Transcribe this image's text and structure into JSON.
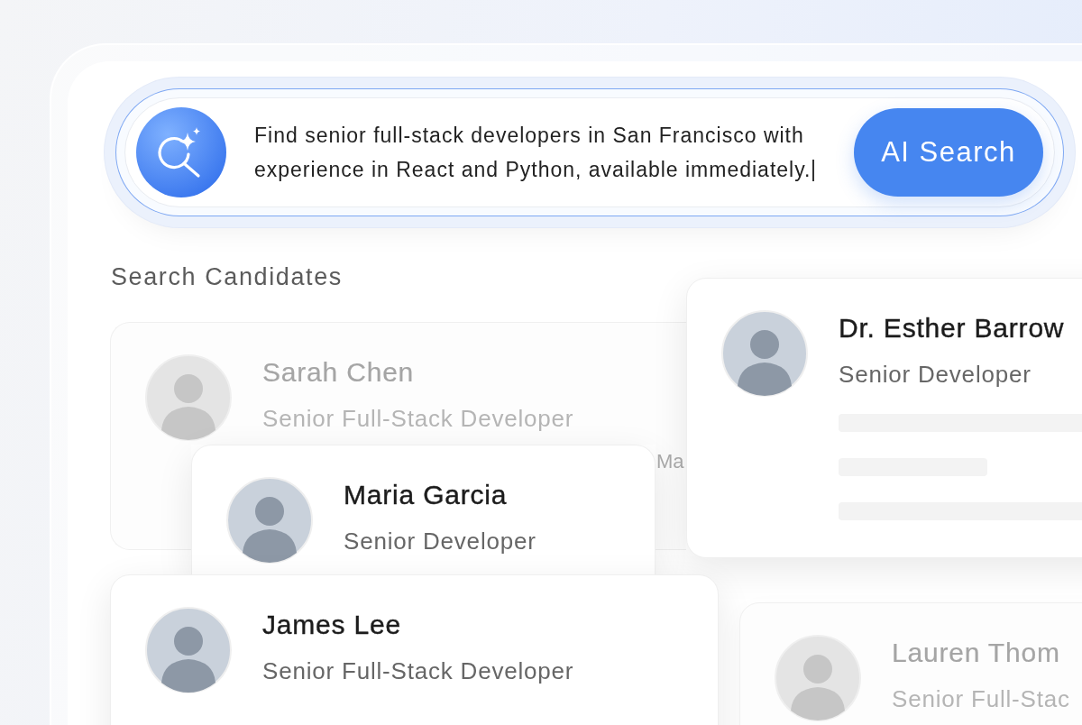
{
  "search": {
    "query": "Find senior full-stack developers in San Francisco with experience in React and Python, available immediately.",
    "button": "AI Search"
  },
  "section_title": "Search Candidates",
  "candidates": [
    {
      "kind": "compact",
      "dimmed": true,
      "name": "Sarah Chen",
      "title": "Senior Full-Stack Developer",
      "detail": "Ma"
    },
    {
      "kind": "compact",
      "dimmed": false,
      "name": "Maria Garcia",
      "title": "Senior Developer"
    },
    {
      "kind": "detailed",
      "dimmed": false,
      "name": "Dr. Esther Barrow",
      "title": "Senior Developer"
    },
    {
      "kind": "compact",
      "dimmed": false,
      "name": "James Lee",
      "title": "Senior Full-Stack Developer"
    },
    {
      "kind": "compact",
      "dimmed": true,
      "name": "Lauren Thom",
      "title": "Senior Full-Stac"
    }
  ]
}
